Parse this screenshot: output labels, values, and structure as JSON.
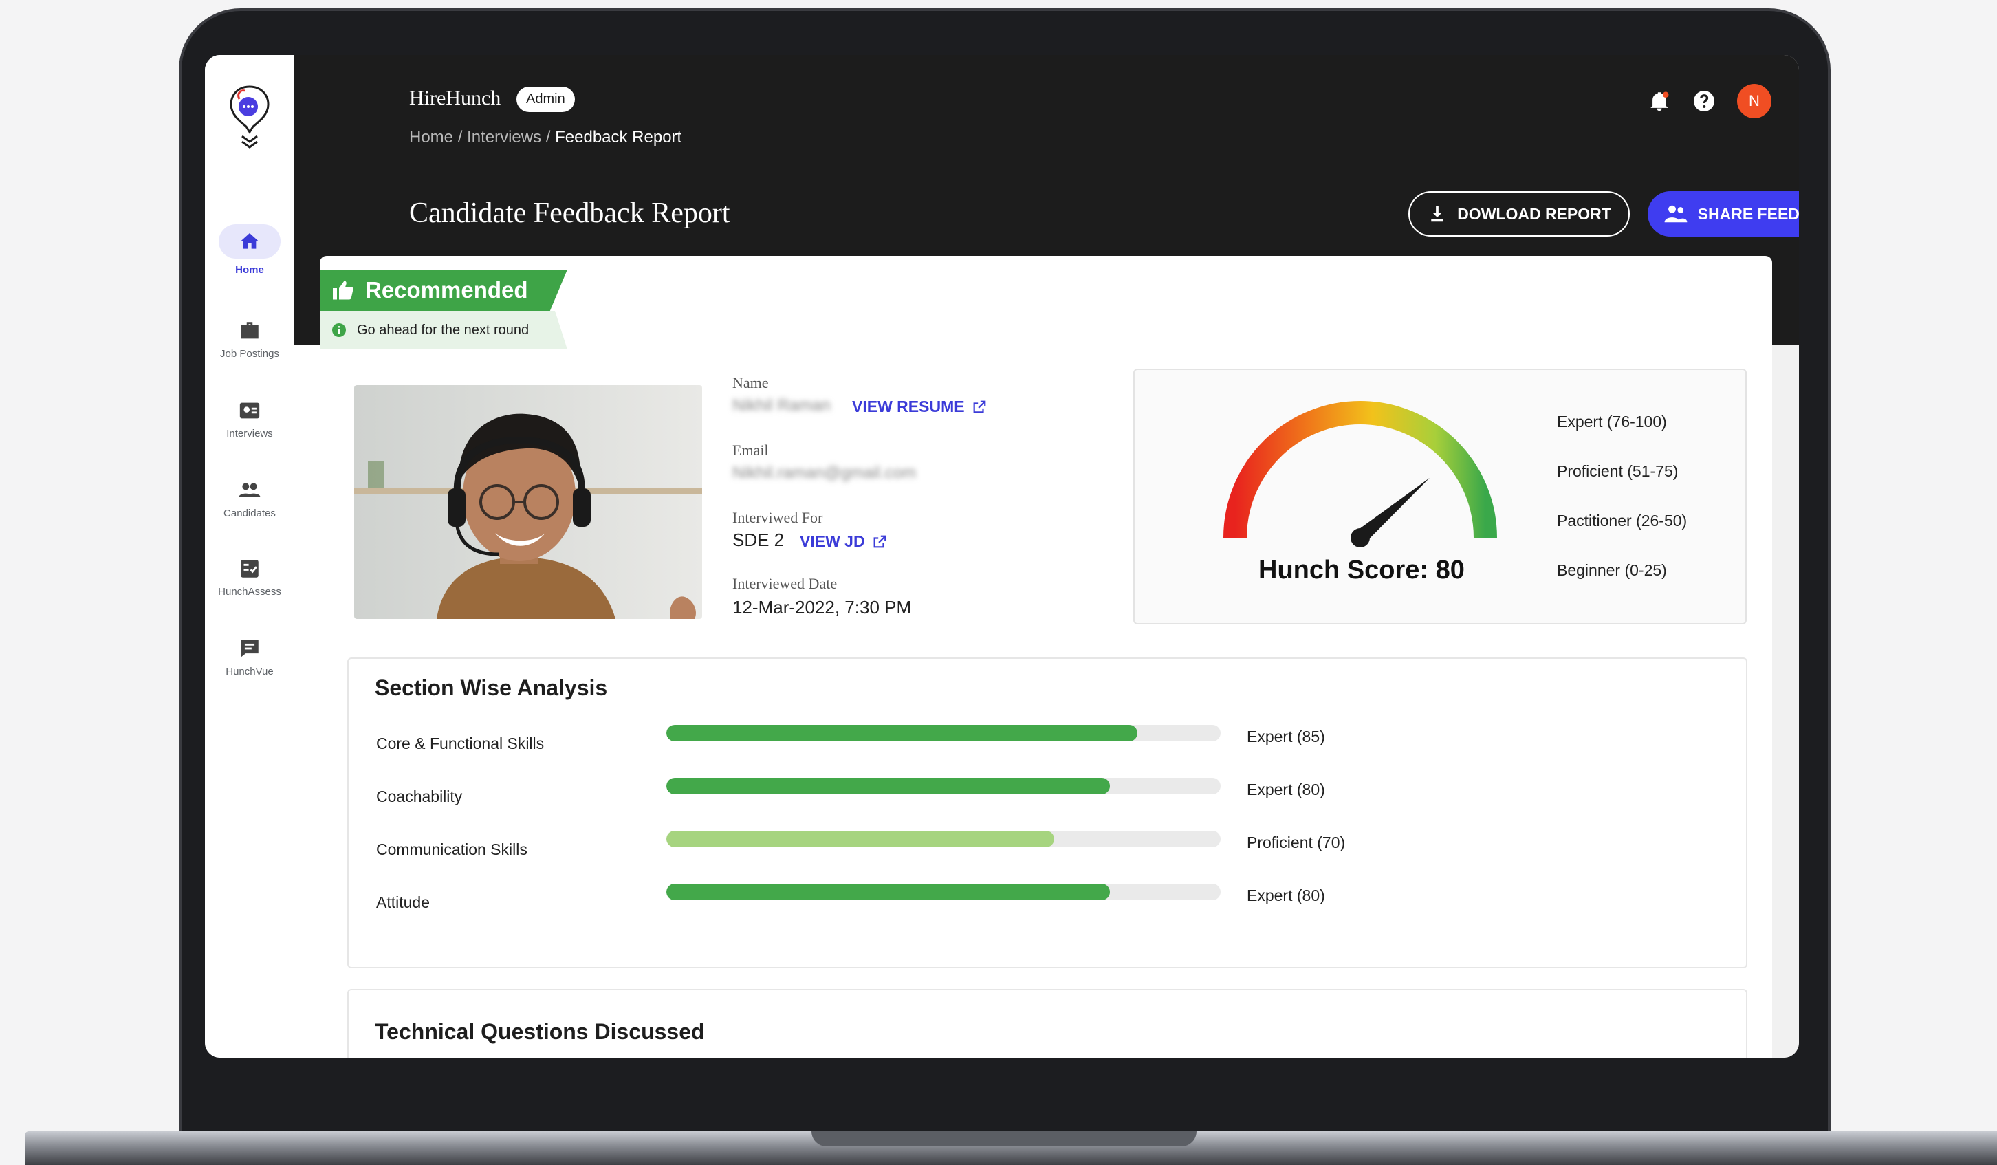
{
  "app": {
    "brand": "HireHunch",
    "role_badge": "Admin",
    "avatar_initial": "N"
  },
  "breadcrumb": {
    "home": "Home",
    "sep1": " / ",
    "interviews": "Interviews",
    "sep2": " / ",
    "current": "Feedback Report"
  },
  "sidebar": {
    "items": [
      {
        "label": "Home",
        "icon": "home-icon",
        "active": true
      },
      {
        "label": "Job Postings",
        "icon": "briefcase-icon"
      },
      {
        "label": "Interviews",
        "icon": "interview-icon"
      },
      {
        "label": "Candidates",
        "icon": "people-icon"
      },
      {
        "label": "HunchAssess",
        "icon": "checklist-icon"
      },
      {
        "label": "HunchVue",
        "icon": "chat-icon"
      }
    ]
  },
  "page": {
    "title": "Candidate Feedback Report",
    "download_label": "DOWLOAD REPORT",
    "share_label": "SHARE FEEDBACK"
  },
  "recommendation": {
    "status": "Recommended",
    "note": "Go ahead for the next round"
  },
  "candidate": {
    "name_label": "Name",
    "name_value": "Nikhil Raman",
    "view_resume": "VIEW RESUME",
    "email_label": "Email",
    "email_value": "Nikhil.raman@gmail.com",
    "interviewed_for_label": "Interviwed For",
    "interviewed_for_value": "SDE 2",
    "view_jd": "VIEW JD",
    "date_label": "Interviewed Date",
    "date_value": "12-Mar-2022, 7:30 PM"
  },
  "score": {
    "label": "Hunch Score: 80",
    "value": 80,
    "max": 100,
    "legend": [
      "Expert (76-100)",
      "Proficient (51-75)",
      "Pactitioner (26-50)",
      "Beginner (0-25)"
    ]
  },
  "section_analysis": {
    "title": "Section Wise Analysis",
    "skills": [
      {
        "name": "Core & Functional Skills",
        "level": "Expert  (85)",
        "value": 85,
        "color": "#43a84a"
      },
      {
        "name": "Coachability",
        "level": "Expert (80)",
        "value": 80,
        "color": "#43a84a"
      },
      {
        "name": "Communication Skills",
        "level": "Proficient (70)",
        "value": 70,
        "color": "#a6d47f"
      },
      {
        "name": "Attitude",
        "level": "Expert (80)",
        "value": 80,
        "color": "#43a84a"
      }
    ]
  },
  "technical": {
    "title": "Technical Questions Discussed"
  },
  "colors": {
    "accent": "#3f3df0",
    "recommended": "#3ea447",
    "avatar": "#f04e23"
  }
}
